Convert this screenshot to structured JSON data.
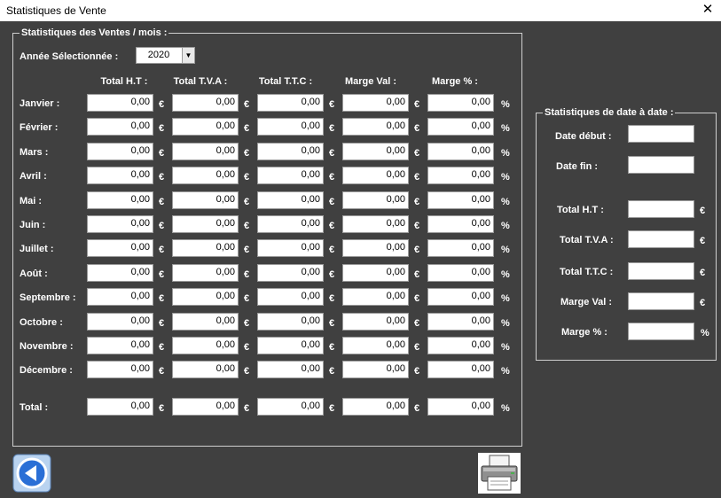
{
  "window": {
    "title": "Statistiques de Vente",
    "close_glyph": "✕"
  },
  "monthly": {
    "frame_title": "Statistiques des Ventes / mois :",
    "year_label": "Année Sélectionnée :",
    "year_value": "2020",
    "columns": [
      "Total H.T :",
      "Total T.V.A :",
      "Total T.T.C :",
      "Marge Val :",
      "Marge %  :"
    ],
    "units": [
      "€",
      "€",
      "€",
      "€",
      "%"
    ],
    "rows": [
      {
        "label": "Janvier :",
        "values": [
          "0,00",
          "0,00",
          "0,00",
          "0,00",
          "0,00"
        ]
      },
      {
        "label": "Février :",
        "values": [
          "0,00",
          "0,00",
          "0,00",
          "0,00",
          "0,00"
        ]
      },
      {
        "label": "Mars :",
        "values": [
          "0,00",
          "0,00",
          "0,00",
          "0,00",
          "0,00"
        ]
      },
      {
        "label": "Avril :",
        "values": [
          "0,00",
          "0,00",
          "0,00",
          "0,00",
          "0,00"
        ]
      },
      {
        "label": "Mai :",
        "values": [
          "0,00",
          "0,00",
          "0,00",
          "0,00",
          "0,00"
        ]
      },
      {
        "label": "Juin :",
        "values": [
          "0,00",
          "0,00",
          "0,00",
          "0,00",
          "0,00"
        ]
      },
      {
        "label": "Juillet :",
        "values": [
          "0,00",
          "0,00",
          "0,00",
          "0,00",
          "0,00"
        ]
      },
      {
        "label": "Août :",
        "values": [
          "0,00",
          "0,00",
          "0,00",
          "0,00",
          "0,00"
        ]
      },
      {
        "label": "Septembre :",
        "values": [
          "0,00",
          "0,00",
          "0,00",
          "0,00",
          "0,00"
        ]
      },
      {
        "label": "Octobre :",
        "values": [
          "0,00",
          "0,00",
          "0,00",
          "0,00",
          "0,00"
        ]
      },
      {
        "label": "Novembre :",
        "values": [
          "0,00",
          "0,00",
          "0,00",
          "0,00",
          "0,00"
        ]
      },
      {
        "label": "Décembre :",
        "values": [
          "0,00",
          "0,00",
          "0,00",
          "0,00",
          "0,00"
        ]
      }
    ],
    "total": {
      "label": "Total  :",
      "values": [
        "0,00",
        "0,00",
        "0,00",
        "0,00",
        "0,00"
      ]
    }
  },
  "date_range": {
    "frame_title": "Statistiques de date à date :",
    "start_label": "Date début :",
    "end_label": "Date fin :",
    "start_value": "",
    "end_value": "",
    "results": [
      {
        "label": "Total H.T :",
        "value": "",
        "unit": "€"
      },
      {
        "label": "Total T.V.A :",
        "value": "",
        "unit": "€"
      },
      {
        "label": "Total T.T.C :",
        "value": "",
        "unit": "€"
      },
      {
        "label": "Marge Val :",
        "value": "",
        "unit": "€"
      },
      {
        "label": "Marge %  :",
        "value": "",
        "unit": "%"
      }
    ]
  },
  "icons": {
    "back": "back-arrow-icon",
    "print": "printer-icon"
  },
  "colors": {
    "background": "#404040",
    "accent_blue": "#2a6fd6"
  }
}
